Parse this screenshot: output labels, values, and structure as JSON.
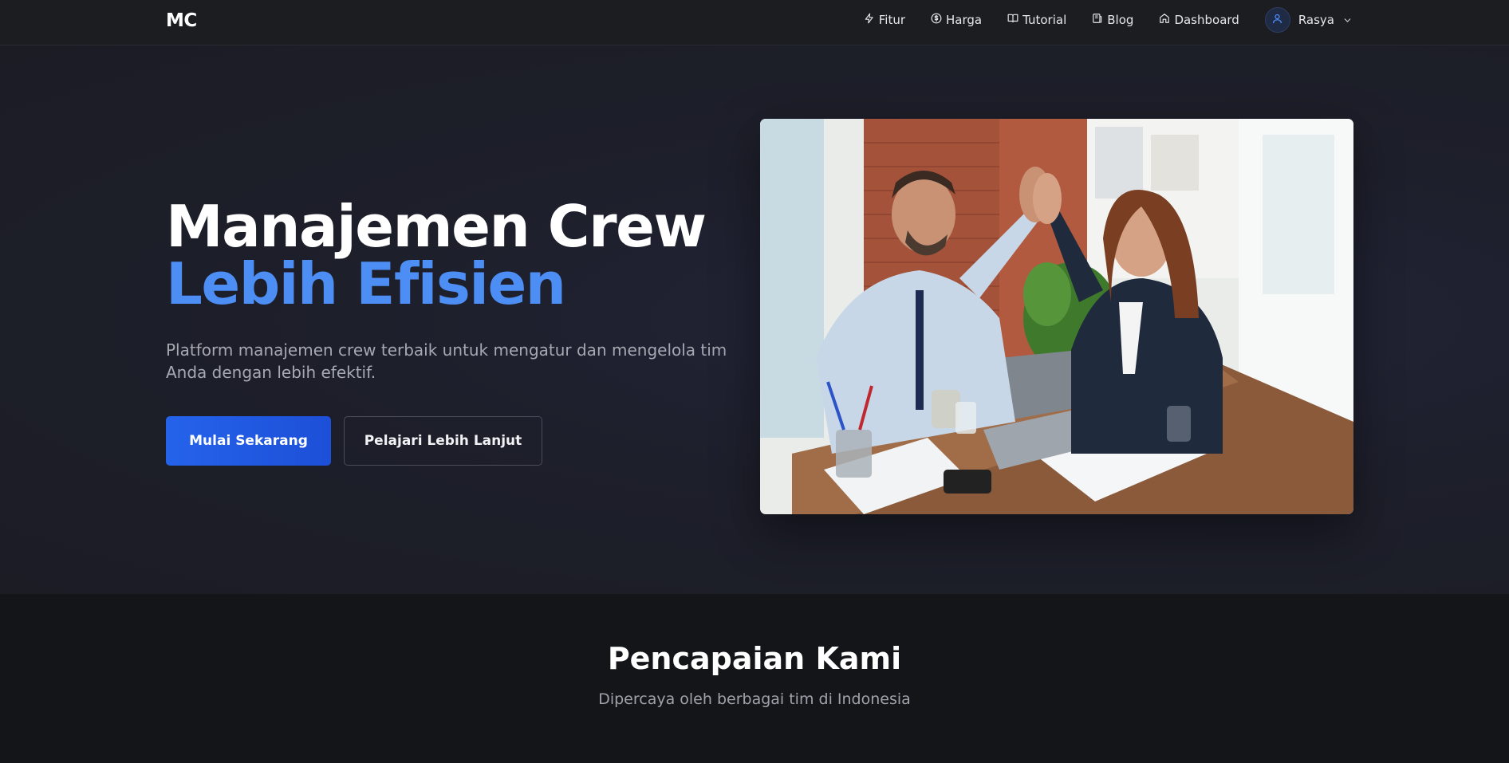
{
  "header": {
    "logo": "MC",
    "nav": [
      {
        "label": "Fitur",
        "icon": "zap-icon"
      },
      {
        "label": "Harga",
        "icon": "dollar-circle-icon"
      },
      {
        "label": "Tutorial",
        "icon": "book-open-icon"
      },
      {
        "label": "Blog",
        "icon": "newspaper-icon"
      },
      {
        "label": "Dashboard",
        "icon": "home-icon"
      }
    ],
    "user": {
      "name": "Rasya",
      "avatar_icon": "user-icon",
      "menu_icon": "chevron-down-icon"
    }
  },
  "hero": {
    "title_line1": "Manajemen Crew",
    "title_line2": "Lebih Efisien",
    "description": "Platform manajemen crew terbaik untuk mengatur dan mengelola tim Anda dengan lebih efektif.",
    "primary_button": "Mulai Sekarang",
    "secondary_button": "Pelajari Lebih Lanjut",
    "image": "photo of two colleagues high-fiving at an office desk"
  },
  "stats": {
    "title": "Pencapaian Kami",
    "subtitle": "Dipercaya oleh berbagai tim di Indonesia"
  },
  "colors": {
    "accent": "#4d8ef5",
    "primary_button": "#2563eb",
    "background": "#1b1c24",
    "nav_background": "#1c1d21"
  }
}
